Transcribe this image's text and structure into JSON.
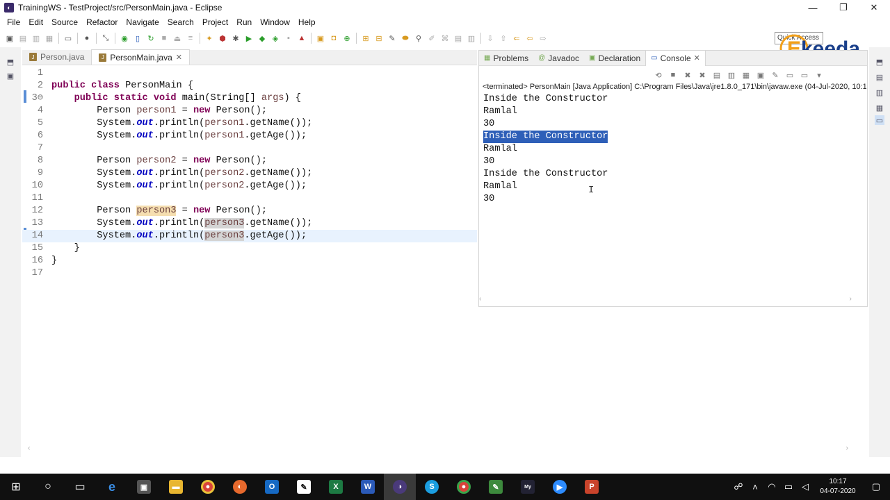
{
  "window": {
    "title": "TrainingWS - TestProject/src/PersonMain.java - Eclipse"
  },
  "menu": [
    "File",
    "Edit",
    "Source",
    "Refactor",
    "Navigate",
    "Search",
    "Project",
    "Run",
    "Window",
    "Help"
  ],
  "quick_access": "Quick Access",
  "logo": {
    "text": "keeda",
    "letter": "E"
  },
  "editor": {
    "tabs": [
      {
        "label": "Person.java"
      },
      {
        "label": "PersonMain.java"
      }
    ],
    "lines": [
      {
        "n": "1",
        "t": ""
      },
      {
        "n": "2",
        "t": "public class PersonMain {"
      },
      {
        "n": "3⊖",
        "t": "    public static void main(String[] args) {"
      },
      {
        "n": "4",
        "t": "        Person person1 = new Person();"
      },
      {
        "n": "5",
        "t": "        System.out.println(person1.getName());"
      },
      {
        "n": "6",
        "t": "        System.out.println(person1.getAge());"
      },
      {
        "n": "7",
        "t": ""
      },
      {
        "n": "8",
        "t": "        Person person2 = new Person();"
      },
      {
        "n": "9",
        "t": "        System.out.println(person2.getName());"
      },
      {
        "n": "10",
        "t": "        System.out.println(person2.getAge());"
      },
      {
        "n": "11",
        "t": ""
      },
      {
        "n": "12",
        "t": "        Person person3 = new Person();"
      },
      {
        "n": "13",
        "t": "        System.out.println(person3.getName());"
      },
      {
        "n": "14",
        "t": "        System.out.println(person3.getAge());"
      },
      {
        "n": "15",
        "t": "    }"
      },
      {
        "n": "16",
        "t": "}"
      },
      {
        "n": "17",
        "t": ""
      }
    ]
  },
  "console": {
    "tabs": [
      {
        "label": "Problems"
      },
      {
        "label": "Javadoc"
      },
      {
        "label": "Declaration"
      },
      {
        "label": "Console"
      }
    ],
    "terminated": "<terminated> PersonMain [Java Application] C:\\Program Files\\Java\\jre1.8.0_171\\bin\\javaw.exe (04-Jul-2020, 10:1",
    "output": [
      "Inside the Constructor",
      "Ramlal",
      "30",
      "Inside the Constructor",
      "Ramlal",
      "30",
      "Inside the Constructor",
      "Ramlal",
      "30"
    ]
  },
  "taskbar": {
    "time": "10:17",
    "date": "04-07-2020"
  }
}
